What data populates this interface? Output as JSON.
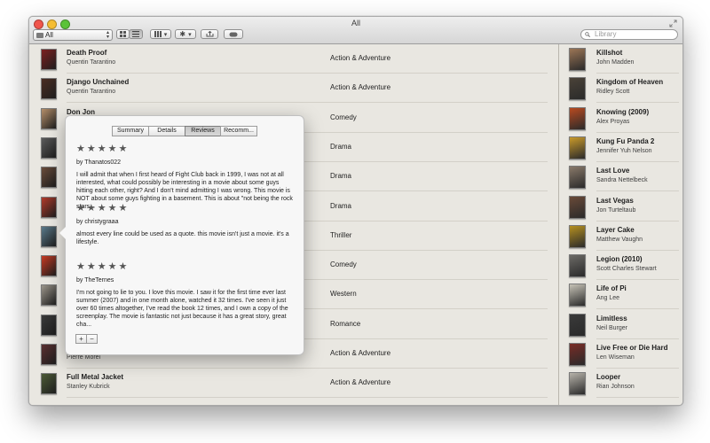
{
  "window": {
    "title": "All",
    "library_select": "All",
    "search_placeholder": "Library"
  },
  "movies": [
    {
      "title": "Death Proof",
      "director": "Quentin Tarantino",
      "genre": "Action & Adventure",
      "poster_color": "#7d2020"
    },
    {
      "title": "Django Unchained",
      "director": "Quentin Tarantino",
      "genre": "Action & Adventure",
      "poster_color": "#4a2d22"
    },
    {
      "title": "Don Jon",
      "director": "",
      "genre": "Comedy",
      "poster_color": "#b58f6a"
    },
    {
      "title": "",
      "director": "",
      "genre": "Drama",
      "poster_color": "#5b5b5b"
    },
    {
      "title": "",
      "director": "",
      "genre": "Drama",
      "poster_color": "#6a4c3b"
    },
    {
      "title": "",
      "director": "",
      "genre": "Drama",
      "poster_color": "#b23a2a"
    },
    {
      "title": "",
      "director": "",
      "genre": "Thriller",
      "poster_color": "#5a7a8a"
    },
    {
      "title": "",
      "director": "",
      "genre": "Comedy",
      "poster_color": "#c73a22"
    },
    {
      "title": "",
      "director": "",
      "genre": "Western",
      "poster_color": "#9b958a"
    },
    {
      "title": "",
      "director": "",
      "genre": "Romance",
      "poster_color": "#3a3a3a"
    },
    {
      "title": "",
      "director": "Pierre Morel",
      "genre": "Action & Adventure",
      "poster_color": "#5b3030"
    },
    {
      "title": "Full Metal Jacket",
      "director": "Stanley Kubrick",
      "genre": "Action & Adventure",
      "poster_color": "#4c5a36"
    }
  ],
  "sidebar_movies": [
    {
      "title": "Killshot",
      "director": "John Madden",
      "poster_color": "#9c7656"
    },
    {
      "title": "Kingdom of Heaven",
      "director": "Ridley Scott",
      "poster_color": "#4a4238"
    },
    {
      "title": "Knowing (2009)",
      "director": "Alex Proyas",
      "poster_color": "#b84a20"
    },
    {
      "title": "Kung Fu Panda 2",
      "director": "Jennifer Yuh Nelson",
      "poster_color": "#c99a2a"
    },
    {
      "title": "Last Love",
      "director": "Sandra Nettelbeck",
      "poster_color": "#8a7a6a"
    },
    {
      "title": "Last Vegas",
      "director": "Jon Turteltaub",
      "poster_color": "#6a4a38"
    },
    {
      "title": "Layer Cake",
      "director": "Matthew Vaughn",
      "poster_color": "#b59020"
    },
    {
      "title": "Legion (2010)",
      "director": "Scott Charles Stewart",
      "poster_color": "#6c6a66"
    },
    {
      "title": "Life of Pi",
      "director": "Ang Lee",
      "poster_color": "#c6c2b6"
    },
    {
      "title": "Limitless",
      "director": "Neil Burger",
      "poster_color": "#3a3a3a"
    },
    {
      "title": "Live Free or Die Hard",
      "director": "Len Wiseman",
      "poster_color": "#7a2c26"
    },
    {
      "title": "Looper",
      "director": "Rian Johnson",
      "poster_color": "#b7b3aa"
    }
  ],
  "popover": {
    "tabs": [
      "Summary",
      "Details",
      "Reviews",
      "Recomm..."
    ],
    "selected_tab": "Reviews",
    "reviews": [
      {
        "stars": "★★★★★",
        "author": "by Thanatos022",
        "text": "I will admit that when I first heard of Fight Club back in 1999, I was not at all interested, what could possibly be interesting in a movie about some guys hitting each other, right? And I don't mind admitting I was wrong. This movie is NOT about some guys fighting in a basement. This is about \"not being the rock stars..."
      },
      {
        "stars": "★★★★★",
        "author": "by christygraaa",
        "text": "almost every line could be used as a quote. this movie isn't just a movie. it's a lifestyle."
      },
      {
        "stars": "★★★★★",
        "author": "by TheTernes",
        "text": "I'm not going to lie to you. I love this movie. I saw it for the first time ever last summer (2007) and in one month alone, watched it 32 times. I've seen it just over 60 times altogether, I've read the book 12 times, and I own a copy of the screenplay. The movie is fantastic not just because it has a great story, great cha..."
      }
    ],
    "add_label": "+",
    "remove_label": "−"
  }
}
